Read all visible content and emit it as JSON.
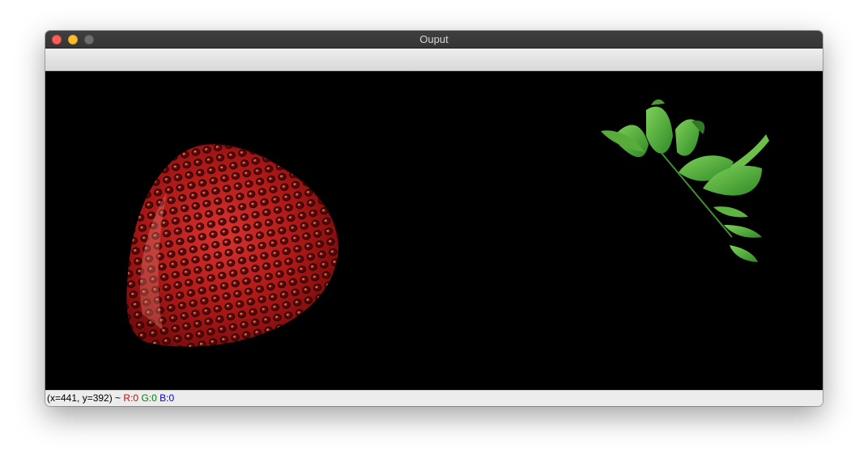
{
  "window": {
    "title": "Ouput"
  },
  "image": {
    "objects": [
      "strawberry-body",
      "strawberry-leaves"
    ],
    "background_color": "#000000"
  },
  "status": {
    "coords": "(x=441, y=392) ~",
    "r_label": "R:0",
    "g_label": "G:0",
    "b_label": "B:0",
    "r_color": "#e00000",
    "g_color": "#008000",
    "b_color": "#0000e0"
  }
}
